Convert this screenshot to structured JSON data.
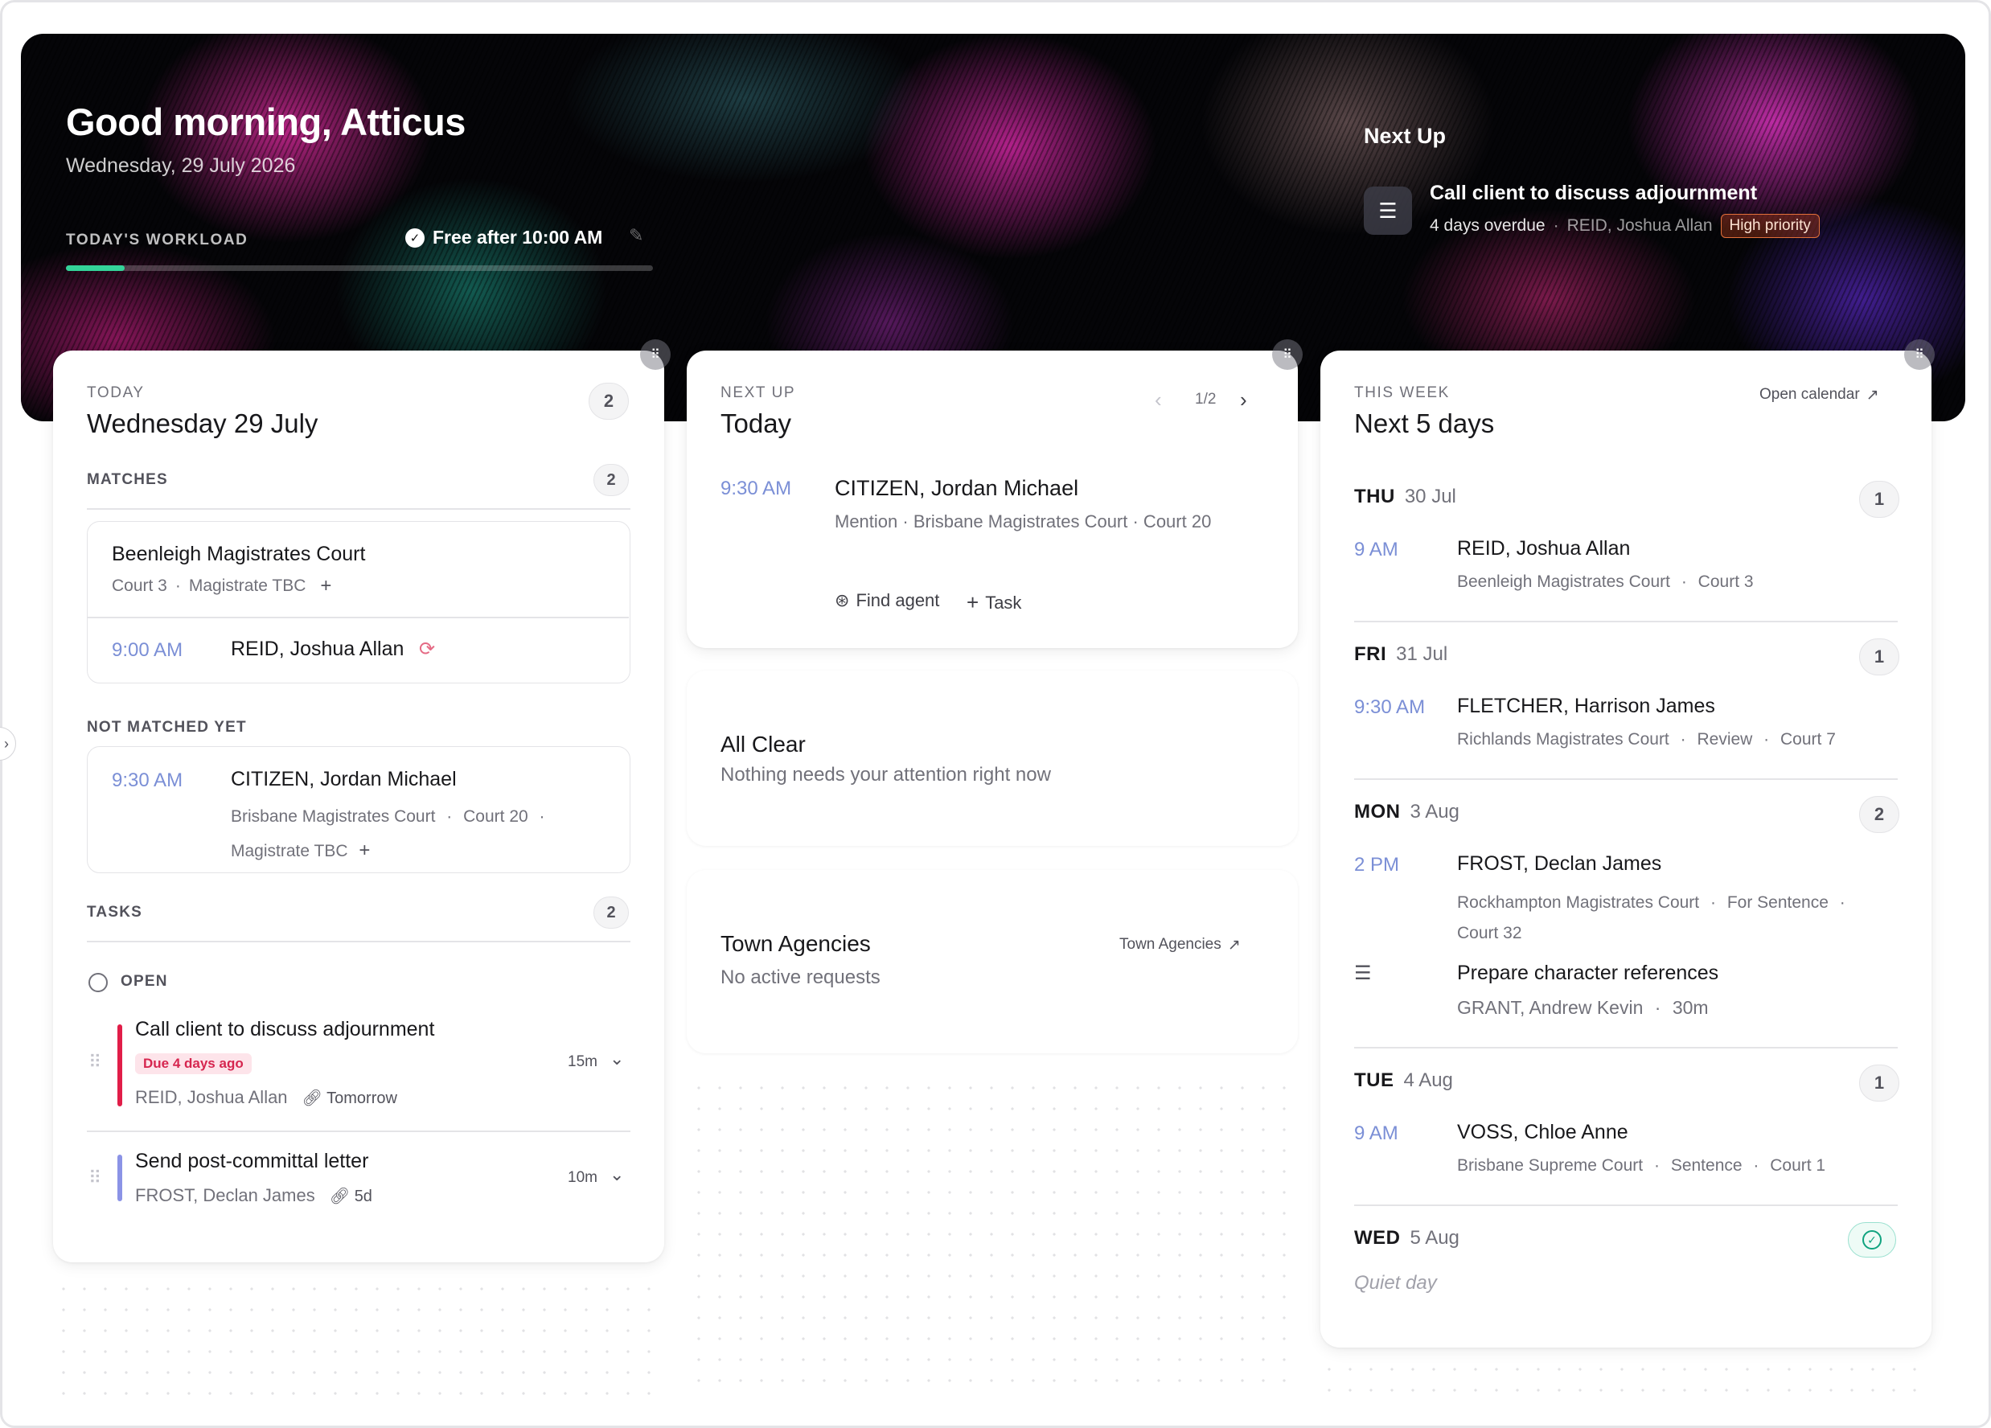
{
  "hero": {
    "greeting": "Good morning, Atticus",
    "date": "Wednesday, 29 July 2026",
    "workload_label": "TODAY'S WORKLOAD",
    "workload_progress": 0.1,
    "free_after": "Free after 10:00 AM",
    "next_up_title": "Next Up",
    "next_task": {
      "title": "Call client to discuss adjournment",
      "overdue": "4 days overdue",
      "separator": "·",
      "client": "REID, Joshua Allan",
      "priority": "High priority"
    }
  },
  "today_card": {
    "eyebrow": "TODAY",
    "title": "Wednesday 29 July",
    "count": "2",
    "matches": {
      "label": "MATCHES",
      "count": "2",
      "court": "Beenleigh Magistrates Court",
      "court_room": "Court 3",
      "dot": "·",
      "magistrate": "Magistrate TBC",
      "time": "9:00 AM",
      "client": "REID, Joshua Allan"
    },
    "not_matched": {
      "label": "NOT MATCHED YET",
      "time": "9:30 AM",
      "client": "CITIZEN, Jordan Michael",
      "court": "Brisbane Magistrates Court",
      "dot": "·",
      "court_room": "Court 20",
      "magistrate": "Magistrate TBC"
    },
    "tasks": {
      "label": "TASKS",
      "count": "2",
      "open_label": "OPEN",
      "items": [
        {
          "title": "Call client to discuss adjournment",
          "due": "Due 4 days ago",
          "client": "REID, Joshua Allan",
          "link": "Tomorrow",
          "duration": "15m",
          "color": "#e11d48"
        },
        {
          "title": "Send post-committal letter",
          "client": "FROST, Declan James",
          "link": "5d",
          "duration": "10m",
          "color": "#8b93e6"
        }
      ]
    }
  },
  "next_up_card": {
    "eyebrow": "NEXT UP",
    "title": "Today",
    "pager": "1/2",
    "time": "9:30 AM",
    "client": "CITIZEN, Jordan Michael",
    "detail": "Mention · Brisbane Magistrates Court · Court 20",
    "find_agent": "Find agent",
    "task": "Task"
  },
  "all_clear_card": {
    "title": "All Clear",
    "subtitle": "Nothing needs your attention right now"
  },
  "agencies_card": {
    "title": "Town Agencies",
    "subtitle": "No active requests",
    "link": "Town Agencies"
  },
  "week_card": {
    "eyebrow": "THIS WEEK",
    "title": "Next 5 days",
    "open_calendar": "Open calendar",
    "dot": "·",
    "days": [
      {
        "day": "THU",
        "date": "30 Jul",
        "count": "1",
        "events": [
          {
            "time": "9 AM",
            "client": "REID, Joshua Allan",
            "court": "Beenleigh Magistrates Court",
            "room": "Court 3"
          }
        ]
      },
      {
        "day": "FRI",
        "date": "31 Jul",
        "count": "1",
        "events": [
          {
            "time": "9:30 AM",
            "client": "FLETCHER, Harrison James",
            "court": "Richlands Magistrates Court",
            "type": "Review",
            "room": "Court 7"
          }
        ]
      },
      {
        "day": "MON",
        "date": "3 Aug",
        "count": "2",
        "events": [
          {
            "time": "2 PM",
            "client": "FROST, Declan James",
            "court": "Rockhampton Magistrates Court",
            "type": "For Sentence",
            "room": "Court 32"
          }
        ],
        "task": {
          "title": "Prepare character references",
          "client": "GRANT, Andrew Kevin",
          "duration": "30m"
        }
      },
      {
        "day": "TUE",
        "date": "4 Aug",
        "count": "1",
        "events": [
          {
            "time": "9 AM",
            "client": "VOSS, Chloe Anne",
            "court": "Brisbane Supreme Court",
            "type": "Sentence",
            "room": "Court 1"
          }
        ]
      },
      {
        "day": "WED",
        "date": "5 Aug",
        "quiet": "Quiet day"
      }
    ]
  }
}
